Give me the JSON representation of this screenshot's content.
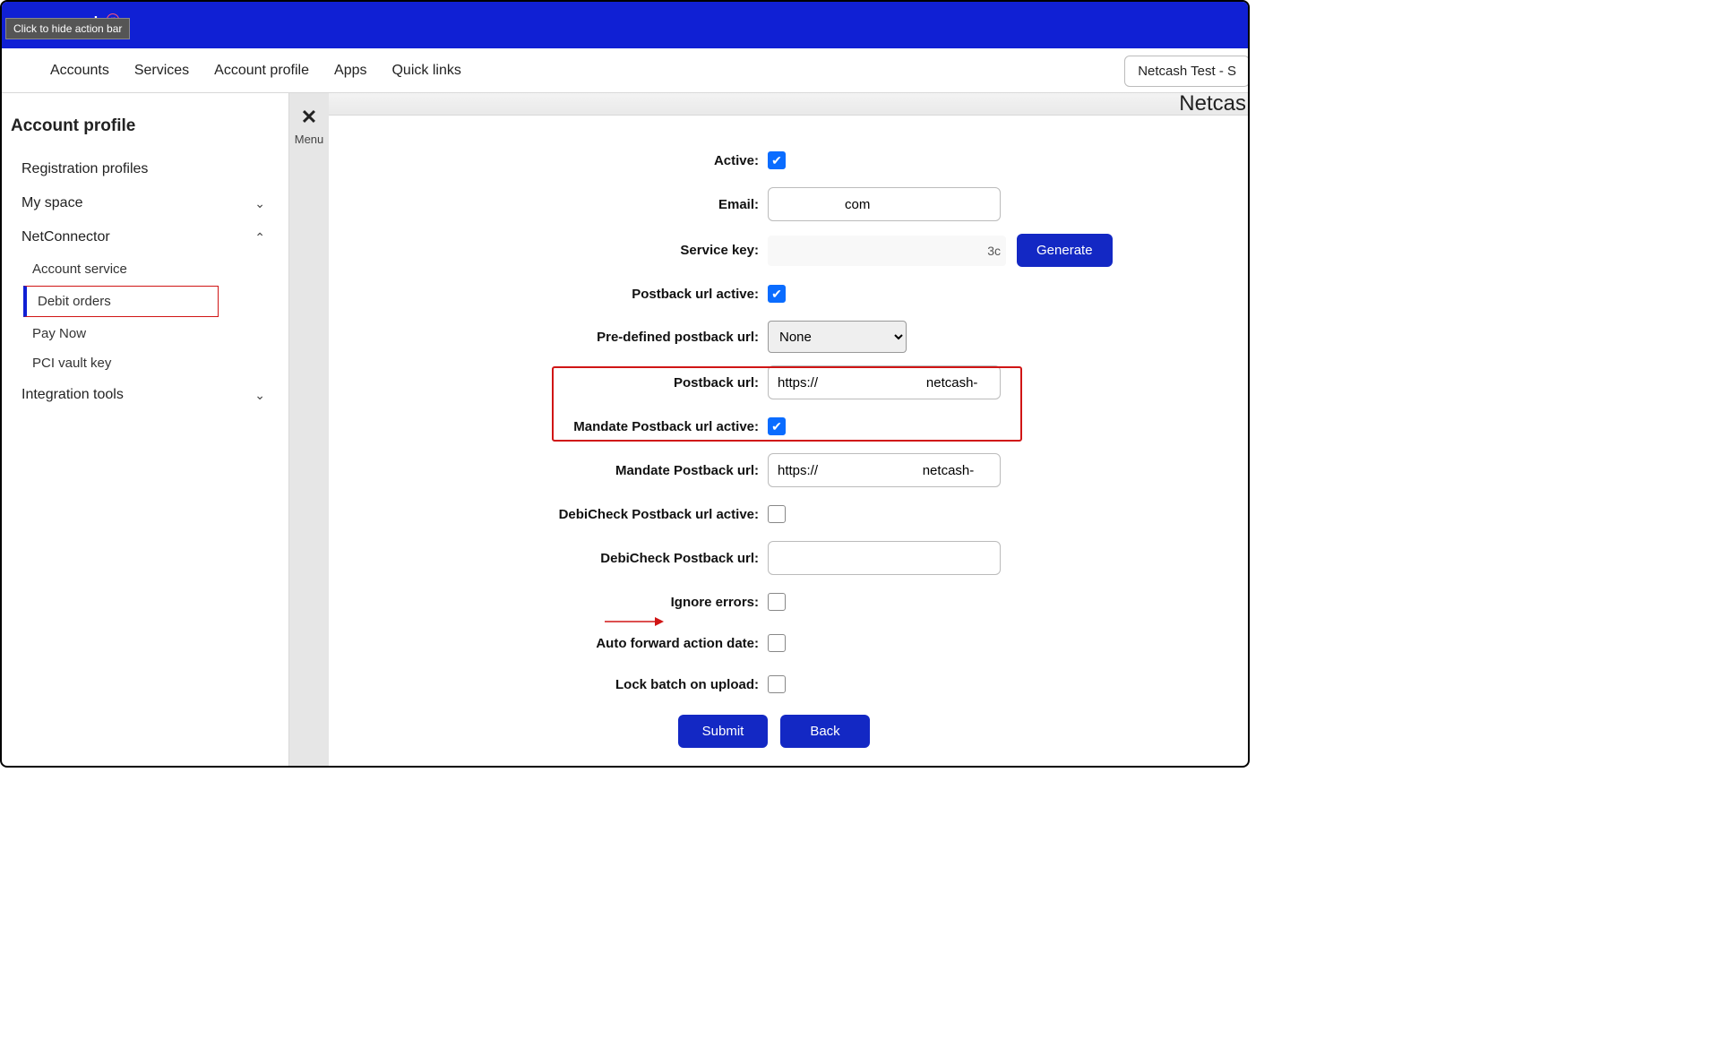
{
  "tooltip": "Click to hide action bar",
  "logo_text": "sh",
  "logo_sup": "n",
  "nav": [
    "Accounts",
    "Services",
    "Account profile",
    "Apps",
    "Quick links"
  ],
  "account_selector": "Netcash Test - S",
  "sidebar": {
    "title": "Account profile",
    "items": {
      "registration": "Registration profiles",
      "myspace": "My space",
      "netconnector": "NetConnector",
      "integration": "Integration tools"
    },
    "netconnector_children": {
      "account_service": "Account service",
      "debit_orders": "Debit orders",
      "pay_now": "Pay Now",
      "pci_vault": "PCI vault key"
    }
  },
  "menu_strip": {
    "label": "Menu"
  },
  "main_header_text": "Netcas",
  "form": {
    "active": {
      "label": "Active:",
      "checked": true
    },
    "email": {
      "label": "Email:",
      "value": "                  com"
    },
    "service_key": {
      "label": "Service key:",
      "value_suffix": "3c",
      "button": "Generate"
    },
    "postback_active": {
      "label": "Postback url active:",
      "checked": true
    },
    "predefined": {
      "label": "Pre-defined postback url:",
      "selected": "None"
    },
    "postback_url": {
      "label": "Postback url:",
      "value": "https://                             netcash-"
    },
    "mandate_active": {
      "label": "Mandate Postback url active:",
      "checked": true
    },
    "mandate_url": {
      "label": "Mandate Postback url:",
      "value": "https://                            netcash-"
    },
    "debicheck_active": {
      "label": "DebiCheck Postback url active:",
      "checked": false
    },
    "debicheck_url": {
      "label": "DebiCheck Postback url:",
      "value": ""
    },
    "ignore_errors": {
      "label": "Ignore errors:",
      "checked": false
    },
    "auto_forward": {
      "label": "Auto forward action date:",
      "checked": false
    },
    "lock_batch": {
      "label": "Lock batch on upload:",
      "checked": false
    },
    "submit": "Submit",
    "back": "Back"
  }
}
